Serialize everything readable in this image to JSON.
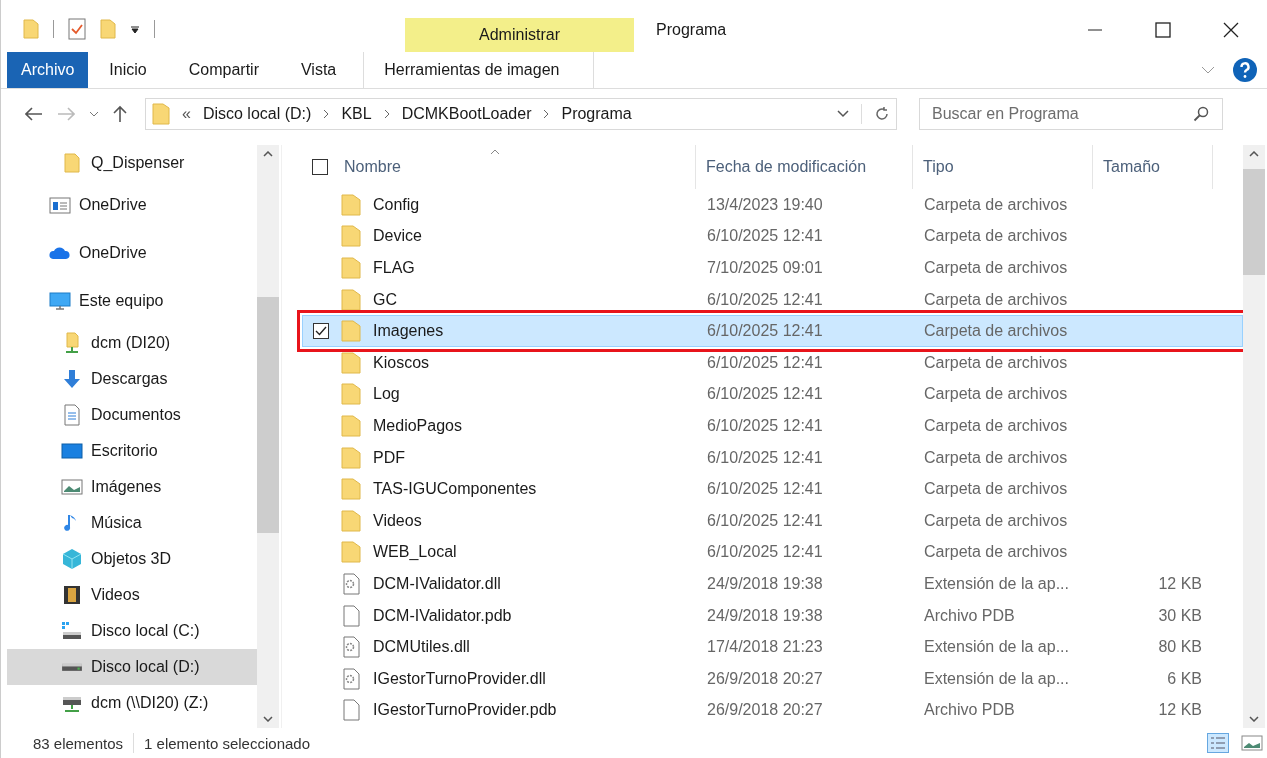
{
  "window": {
    "title": "Programa",
    "context_tab": "Administrar"
  },
  "ribbon": {
    "tabs": [
      {
        "label": "Archivo",
        "kind": "file",
        "selected": false
      },
      {
        "label": "Inicio",
        "kind": "tab",
        "selected": false
      },
      {
        "label": "Compartir",
        "kind": "tab",
        "selected": false
      },
      {
        "label": "Vista",
        "kind": "tab",
        "selected": false
      },
      {
        "label": "Herramientas de imagen",
        "kind": "context",
        "selected": false
      }
    ]
  },
  "address": {
    "overflow": "«",
    "path": [
      "Disco local (D:)",
      "KBL",
      "DCMKBootLoader",
      "Programa"
    ]
  },
  "search": {
    "placeholder": "Buscar en Programa"
  },
  "nav": {
    "items": [
      {
        "label": "Q_Dispenser",
        "kind": "folder",
        "selected": false
      },
      {
        "label": "OneDrive",
        "kind": "window",
        "selected": false
      },
      {
        "label": "OneDrive",
        "kind": "cloud",
        "selected": false
      },
      {
        "label": "Este equipo",
        "kind": "computer",
        "selected": false,
        "children": [
          {
            "label": "dcm (DI20)",
            "kind": "netfolder",
            "selected": false
          },
          {
            "label": "Descargas",
            "kind": "download",
            "selected": false
          },
          {
            "label": "Documentos",
            "kind": "document",
            "selected": false
          },
          {
            "label": "Escritorio",
            "kind": "desktop",
            "selected": false
          },
          {
            "label": "Imágenes",
            "kind": "pictures",
            "selected": false
          },
          {
            "label": "Música",
            "kind": "music",
            "selected": false
          },
          {
            "label": "Objetos 3D",
            "kind": "cube",
            "selected": false
          },
          {
            "label": "Videos",
            "kind": "film",
            "selected": false
          },
          {
            "label": "Disco local (C:)",
            "kind": "sysdrive",
            "selected": false
          },
          {
            "label": "Disco local (D:)",
            "kind": "drive",
            "selected": true
          },
          {
            "label": "dcm (\\\\DI20) (Z:)",
            "kind": "netdrive",
            "selected": false
          }
        ]
      }
    ]
  },
  "table": {
    "select_all_checked": false,
    "columns": [
      "Nombre",
      "Fecha de modificación",
      "Tipo",
      "Tamaño"
    ],
    "rows": [
      {
        "name": "Config",
        "date": "13/4/2023 19:40",
        "type": "Carpeta de archivos",
        "kind": "folder",
        "selected": false,
        "outlined": false
      },
      {
        "name": "Device",
        "date": "6/10/2025 12:41",
        "type": "Carpeta de archivos",
        "kind": "folder",
        "selected": false,
        "outlined": false
      },
      {
        "name": "FLAG",
        "date": "7/10/2025 09:01",
        "type": "Carpeta de archivos",
        "kind": "folder",
        "selected": false,
        "outlined": false
      },
      {
        "name": "GC",
        "date": "6/10/2025 12:41",
        "type": "Carpeta de archivos",
        "kind": "folder",
        "selected": false,
        "outlined": false
      },
      {
        "name": "Imagenes",
        "date": "6/10/2025 12:41",
        "type": "Carpeta de archivos",
        "kind": "folder",
        "selected": true,
        "outlined": true
      },
      {
        "name": "Kioscos",
        "date": "6/10/2025 12:41",
        "type": "Carpeta de archivos",
        "kind": "folder",
        "selected": false,
        "outlined": false
      },
      {
        "name": "Log",
        "date": "6/10/2025 12:41",
        "type": "Carpeta de archivos",
        "kind": "folder",
        "selected": false,
        "outlined": false
      },
      {
        "name": "MedioPagos",
        "date": "6/10/2025 12:41",
        "type": "Carpeta de archivos",
        "kind": "folder",
        "selected": false,
        "outlined": false
      },
      {
        "name": "PDF",
        "date": "6/10/2025 12:41",
        "type": "Carpeta de archivos",
        "kind": "folder",
        "selected": false,
        "outlined": false
      },
      {
        "name": "TAS-IGUComponentes",
        "date": "6/10/2025 12:41",
        "type": "Carpeta de archivos",
        "kind": "folder",
        "selected": false,
        "outlined": false
      },
      {
        "name": "Videos",
        "date": "6/10/2025 12:41",
        "type": "Carpeta de archivos",
        "kind": "folder",
        "selected": false,
        "outlined": false
      },
      {
        "name": "WEB_Local",
        "date": "6/10/2025 12:41",
        "type": "Carpeta de archivos",
        "kind": "folder",
        "selected": false,
        "outlined": false
      },
      {
        "name": "DCM-IValidator.dll",
        "date": "24/9/2018 19:38",
        "type": "Extensión de la ap...",
        "size": "12 KB",
        "kind": "dll",
        "selected": false,
        "outlined": false
      },
      {
        "name": "DCM-IValidator.pdb",
        "date": "24/9/2018 19:38",
        "type": "Archivo PDB",
        "size": "30 KB",
        "kind": "file",
        "selected": false,
        "outlined": false
      },
      {
        "name": "DCMUtiles.dll",
        "date": "17/4/2018 21:23",
        "type": "Extensión de la ap...",
        "size": "80 KB",
        "kind": "dll",
        "selected": false,
        "outlined": false
      },
      {
        "name": "IGestorTurnoProvider.dll",
        "date": "26/9/2018 20:27",
        "type": "Extensión de la ap...",
        "size": "6 KB",
        "kind": "dll",
        "selected": false,
        "outlined": false
      },
      {
        "name": "IGestorTurnoProvider.pdb",
        "date": "26/9/2018 20:27",
        "type": "Archivo PDB",
        "size": "12 KB",
        "kind": "file",
        "selected": false,
        "outlined": false
      }
    ]
  },
  "status_bar": {
    "count": "83 elementos",
    "selection": "1 elemento seleccionado"
  }
}
